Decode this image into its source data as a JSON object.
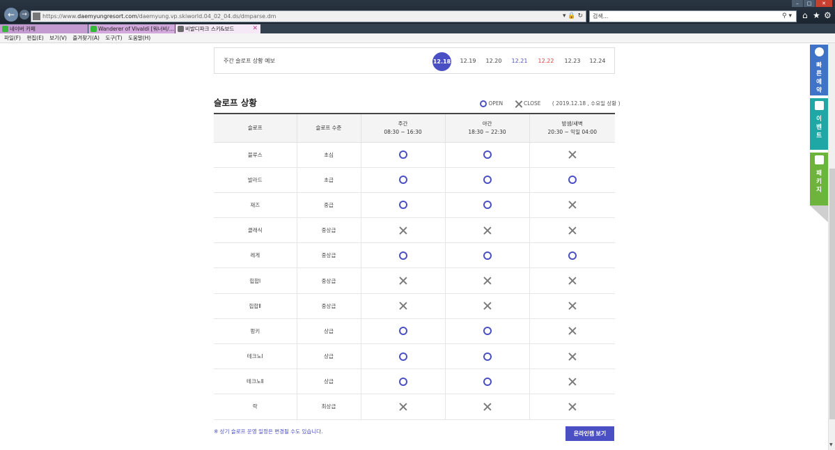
{
  "browser": {
    "url_prefix": "https://www.",
    "url_host": "daemyungresort.com",
    "url_path": "/daemyung.vp.skiworld.04_02_04.ds/dmparse.dm",
    "search_placeholder": "검색...",
    "tabs": [
      {
        "label": "네이버 카페"
      },
      {
        "label": "Wanderer of Vivaldi [워너비/..."
      },
      {
        "label": "비발디파크 스키&보드"
      }
    ],
    "menu": [
      "파일(F)",
      "편집(E)",
      "보기(V)",
      "즐겨찾기(A)",
      "도구(T)",
      "도움말(H)"
    ]
  },
  "weekly": {
    "title": "주간 슬로프 상황 예보",
    "dates": [
      {
        "label": "12.18",
        "state": "active"
      },
      {
        "label": "12.19",
        "state": "normal"
      },
      {
        "label": "12.20",
        "state": "normal"
      },
      {
        "label": "12.21",
        "state": "saturday"
      },
      {
        "label": "12.22",
        "state": "sunday"
      },
      {
        "label": "12.23",
        "state": "normal"
      },
      {
        "label": "12.24",
        "state": "normal"
      }
    ]
  },
  "slope_status": {
    "title": "슬로프 상황",
    "legend_open": "OPEN",
    "legend_close": "CLOSE",
    "as_of": "( 2019.12.18 , 수요일 상황 )",
    "headers": {
      "slope": "슬로프",
      "level": "슬로프 수준",
      "day_label": "주간",
      "day_time": "08:30 ~ 16:30",
      "evening_label": "야간",
      "evening_time": "18:30 ~ 22:30",
      "night_label": "밤샘/새벽",
      "night_time": "20:30 ~ 익일 04:00"
    },
    "rows": [
      {
        "slope": "블루스",
        "level": "초심",
        "day": "open",
        "evening": "open",
        "night": "close"
      },
      {
        "slope": "발라드",
        "level": "초급",
        "day": "open",
        "evening": "open",
        "night": "open"
      },
      {
        "slope": "재즈",
        "level": "중급",
        "day": "open",
        "evening": "open",
        "night": "close"
      },
      {
        "slope": "클래식",
        "level": "중상급",
        "day": "close",
        "evening": "close",
        "night": "close"
      },
      {
        "slope": "레게",
        "level": "중상급",
        "day": "open",
        "evening": "open",
        "night": "open"
      },
      {
        "slope": "힙합Ⅰ",
        "level": "중상급",
        "day": "close",
        "evening": "close",
        "night": "close"
      },
      {
        "slope": "힙합Ⅱ",
        "level": "중상급",
        "day": "close",
        "evening": "close",
        "night": "close"
      },
      {
        "slope": "펑키",
        "level": "상급",
        "day": "open",
        "evening": "open",
        "night": "close"
      },
      {
        "slope": "테크노Ⅰ",
        "level": "상급",
        "day": "open",
        "evening": "open",
        "night": "close"
      },
      {
        "slope": "테크노Ⅱ",
        "level": "상급",
        "day": "open",
        "evening": "open",
        "night": "close"
      },
      {
        "slope": "락",
        "level": "최상급",
        "day": "close",
        "evening": "close",
        "night": "close"
      }
    ],
    "notice": "※ 상기 슬로프 운영 일정은 변경될 수도 있습니다.",
    "webcam_button": "온라인캠 보기"
  },
  "side_menu": [
    {
      "label": "빠른예약",
      "icon": "alarm-clock-icon",
      "color": "#3f73c8"
    },
    {
      "label": "이벤트",
      "icon": "balloon-icon",
      "color": "#1fa7a5"
    },
    {
      "label": "패키지",
      "icon": "package-icon",
      "color": "#6cb43c"
    }
  ],
  "colors": {
    "accent": "#4a4fc3",
    "sunday": "#e5393c",
    "close_mark": "#7a7a7a"
  }
}
